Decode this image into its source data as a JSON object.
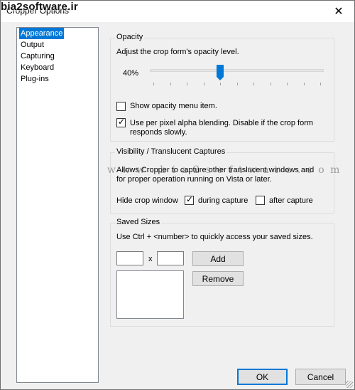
{
  "window": {
    "title": "Cropper Options",
    "watermark_top": "bia2software.ir",
    "watermark_mid": "w w w . b i a 2 s o f t w a r e . c o m"
  },
  "nav": {
    "items": [
      {
        "label": "Appearance",
        "selected": true
      },
      {
        "label": "Output",
        "selected": false
      },
      {
        "label": "Capturing",
        "selected": false
      },
      {
        "label": "Keyboard",
        "selected": false
      },
      {
        "label": "Plug-ins",
        "selected": false
      }
    ]
  },
  "opacity": {
    "title": "Opacity",
    "description": "Adjust the crop form's opacity level.",
    "value_label": "40%",
    "slider_fraction": 0.4,
    "show_menu_label": "Show opacity menu item.",
    "show_menu_checked": false,
    "alpha_label_line1": "Use per pixel alpha blending. Disable if the crop form",
    "alpha_label_line2": "responds slowly.",
    "alpha_checked": true
  },
  "visibility": {
    "title": "Visibility / Translucent Captures",
    "desc_line1": "Allows Cropper to capture other translucent windows and",
    "desc_line2": "for proper operation running on Vista or later.",
    "hide_label": "Hide crop window",
    "during_label": "during capture",
    "during_checked": true,
    "after_label": "after capture",
    "after_checked": false
  },
  "saved_sizes": {
    "title": "Saved Sizes",
    "description": "Use Ctrl + <number> to quickly access your saved sizes.",
    "width_value": "",
    "height_value": "",
    "x_label": "x",
    "add_label": "Add",
    "remove_label": "Remove"
  },
  "footer": {
    "ok_label": "OK",
    "cancel_label": "Cancel"
  },
  "colors": {
    "accent": "#0078d7",
    "dialog_bg": "#f0f0f0"
  }
}
